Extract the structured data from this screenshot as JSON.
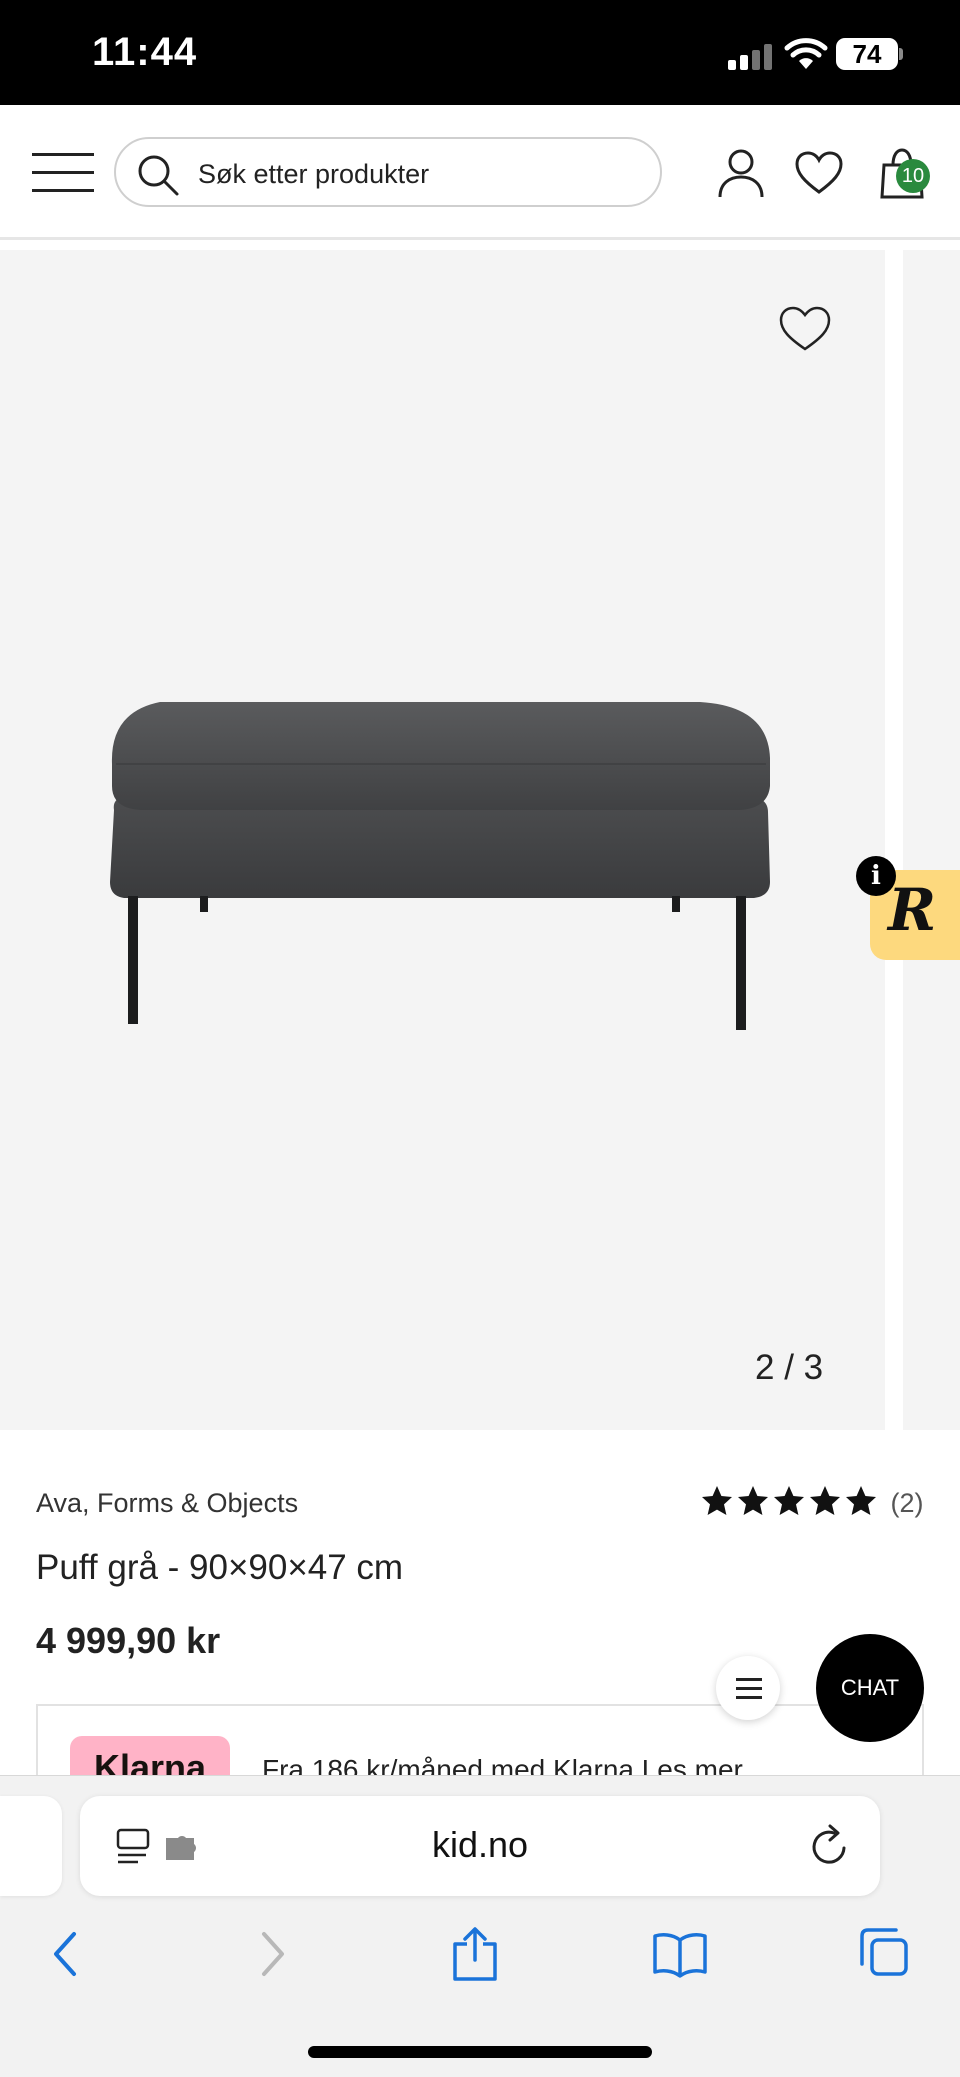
{
  "status_bar": {
    "time": "11:44",
    "battery": "74"
  },
  "header": {
    "search_placeholder": "Søk etter produkter",
    "cart_count": "10"
  },
  "gallery": {
    "counter": "2 / 3",
    "current_index": 2,
    "total": 3,
    "widget_letter": "R",
    "widget_info": "i"
  },
  "product": {
    "brand": "Ava, Forms & Objects",
    "title": "Puff grå - 90×90×47 cm",
    "price": "4 999,90 kr",
    "rating_stars": 5,
    "rating_count": "(2)"
  },
  "klarna": {
    "logo": "Klarna",
    "text": "Fra 186 kr/måned med Klarna Les mer"
  },
  "floating": {
    "chat_label": "CHAT"
  },
  "browser": {
    "domain": "kid.no"
  },
  "colors": {
    "badge_green": "#2a8a3e",
    "klarna_pink": "#ffb3c7",
    "widget_yellow": "#fdd97e",
    "safari_blue": "#1a73d9"
  }
}
